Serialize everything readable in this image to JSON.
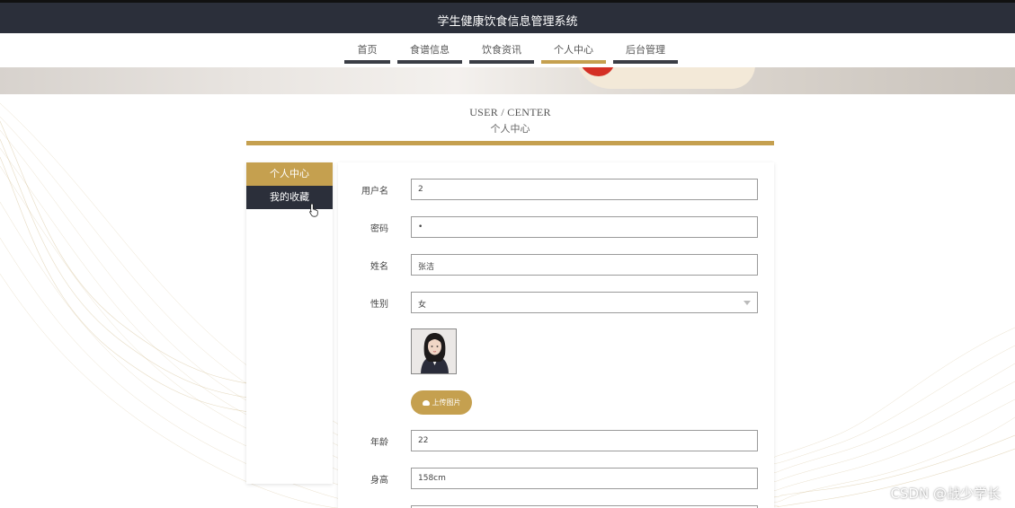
{
  "header": {
    "title": "学生健康饮食信息管理系统"
  },
  "nav": {
    "items": [
      {
        "label": "首页",
        "active": false
      },
      {
        "label": "食谱信息",
        "active": false
      },
      {
        "label": "饮食资讯",
        "active": false
      },
      {
        "label": "个人中心",
        "active": true
      },
      {
        "label": "后台管理",
        "active": false
      }
    ]
  },
  "section": {
    "title_en": "USER / CENTER",
    "title_cn": "个人中心"
  },
  "sidebar": {
    "items": [
      {
        "label": "个人中心",
        "active": true
      },
      {
        "label": "我的收藏",
        "active": false
      }
    ]
  },
  "form": {
    "username": {
      "label": "用户名",
      "value": "2"
    },
    "password": {
      "label": "密码",
      "value": "•"
    },
    "name": {
      "label": "姓名",
      "value": "张洁"
    },
    "gender": {
      "label": "性别",
      "value": "女"
    },
    "upload_label": "上传图片",
    "age": {
      "label": "年龄",
      "value": "22"
    },
    "height": {
      "label": "身高",
      "value": "158cm"
    }
  },
  "watermark": "CSDN @战少学长",
  "colors": {
    "accent": "#c5a04f",
    "header_bg": "#2b2f3a",
    "nav_underline": "#3a3d45"
  }
}
